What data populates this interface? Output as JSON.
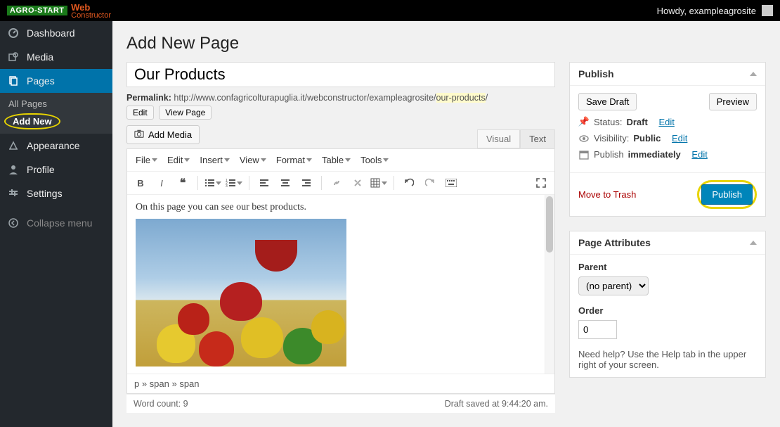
{
  "topbar": {
    "brand_agro": "AGRO-START",
    "brand_web": "Web",
    "brand_constructor": "Constructor",
    "greeting": "Howdy, exampleagrosite"
  },
  "sidebar": {
    "items": [
      {
        "label": "Dashboard"
      },
      {
        "label": "Media"
      },
      {
        "label": "Pages"
      },
      {
        "label": "Appearance"
      },
      {
        "label": "Profile"
      },
      {
        "label": "Settings"
      }
    ],
    "sub_pages": {
      "all": "All Pages",
      "add_new": "Add New"
    },
    "collapse": "Collapse menu"
  },
  "page": {
    "heading": "Add New Page",
    "title_value": "Our Products",
    "permalink_label": "Permalink:",
    "permalink_base": "http://www.confagricolturapuglia.it/webconstructor/exampleagrosite/",
    "slug": "our-products",
    "slash": "/",
    "edit_btn": "Edit",
    "view_btn": "View Page",
    "add_media": "Add Media",
    "tabs": {
      "visual": "Visual",
      "text": "Text"
    },
    "menus": [
      "File",
      "Edit",
      "Insert",
      "View",
      "Format",
      "Table",
      "Tools"
    ],
    "editor_text": "On this page you can see our best products.",
    "path": "p » span » span",
    "word_count_label": "Word count: ",
    "word_count": "9",
    "draft_saved": "Draft saved at 9:44:20 am."
  },
  "publish": {
    "title": "Publish",
    "save_draft": "Save Draft",
    "preview": "Preview",
    "status_label": "Status: ",
    "status_value": "Draft",
    "visibility_label": "Visibility: ",
    "visibility_value": "Public",
    "publish_on_label": "Publish ",
    "publish_on_value": "immediately",
    "edit": "Edit",
    "trash": "Move to Trash",
    "publish_btn": "Publish"
  },
  "attributes": {
    "title": "Page Attributes",
    "parent_label": "Parent",
    "parent_value": "(no parent)",
    "order_label": "Order",
    "order_value": "0",
    "help_text": "Need help? Use the Help tab in the upper right of your screen."
  }
}
